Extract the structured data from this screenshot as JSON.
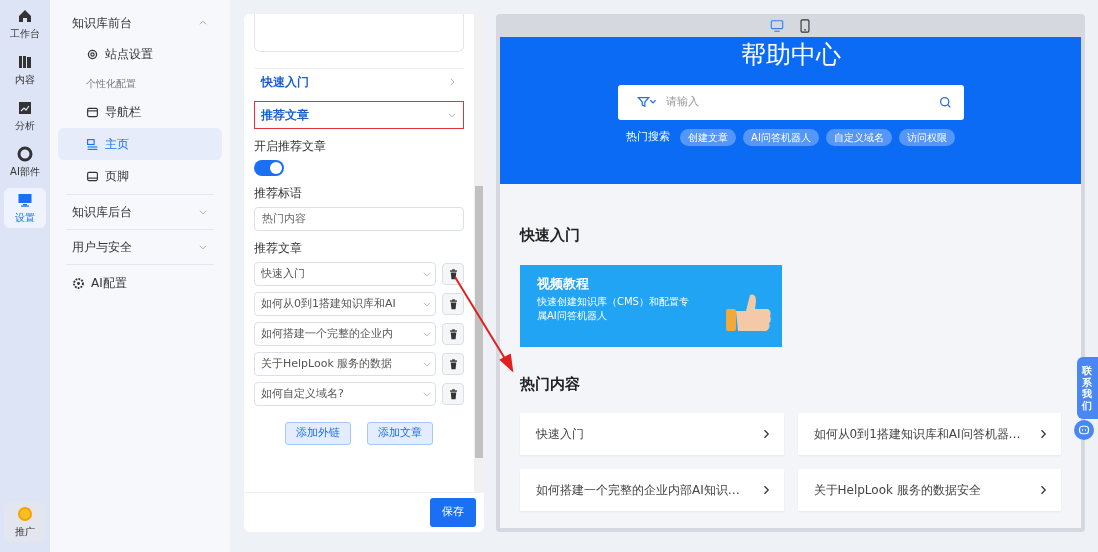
{
  "rail": {
    "items": [
      {
        "label": "工作台",
        "selected": false
      },
      {
        "label": "内容",
        "selected": false
      },
      {
        "label": "分析",
        "selected": false
      },
      {
        "label": "AI部件",
        "selected": false
      },
      {
        "label": "设置",
        "selected": true
      }
    ],
    "bottom": {
      "label": "推广"
    }
  },
  "nav": [
    {
      "kind": "group",
      "label": "知识库前台",
      "expanded": true,
      "children": [
        {
          "kind": "item",
          "label": "站点设置",
          "selected": false
        },
        {
          "kind": "caption",
          "label": "个性化配置"
        },
        {
          "kind": "item",
          "label": "导航栏",
          "selected": false
        },
        {
          "kind": "item",
          "label": "主页",
          "selected": true
        },
        {
          "kind": "item",
          "label": "页脚",
          "selected": false
        }
      ]
    },
    {
      "kind": "group",
      "label": "知识库后台",
      "expanded": false
    },
    {
      "kind": "group",
      "label": "用户与安全",
      "expanded": false
    },
    {
      "kind": "item",
      "label": "AI配置",
      "selected": false
    }
  ],
  "settings": {
    "sections": [
      {
        "title": "快速入门",
        "expanded": false,
        "highlighted": false
      },
      {
        "title": "推荐文章",
        "expanded": true,
        "highlighted": true
      }
    ],
    "enable_label": "开启推荐文章",
    "enabled": true,
    "slogan_label": "推荐标语",
    "slogan_value": "热门内容",
    "articles_label": "推荐文章",
    "articles": [
      "快速入门",
      "如何从0到1搭建知识库和AI",
      "如何搭建一个完整的企业内",
      "关于HelpLook 服务的数据",
      "如何自定义域名?"
    ],
    "add_buttons": [
      "添加外链",
      "添加文章"
    ],
    "save": "保存"
  },
  "preview": {
    "devices": [
      {
        "kind": "desktop",
        "selected": true
      },
      {
        "kind": "mobile",
        "selected": false
      }
    ],
    "title": "帮助中心",
    "search_placeholder": "请输入",
    "hot_label": "热门搜索",
    "hot_tags": [
      "创建文章",
      "AI问答机器人",
      "自定义域名",
      "访问权限"
    ],
    "quick_title": "快速入门",
    "banner": {
      "title": "视频教程",
      "text": "快速创建知识库（CMS）和配置专属AI问答机器人"
    },
    "popular_title": "热门内容",
    "popular": [
      "快速入门",
      "如何从0到1搭建知识库和AI问答机器…",
      "如何搭建一个完整的企业内部AI知识…",
      "关于HelpLook 服务的数据安全"
    ]
  },
  "contact": {
    "label": "联系我们"
  }
}
